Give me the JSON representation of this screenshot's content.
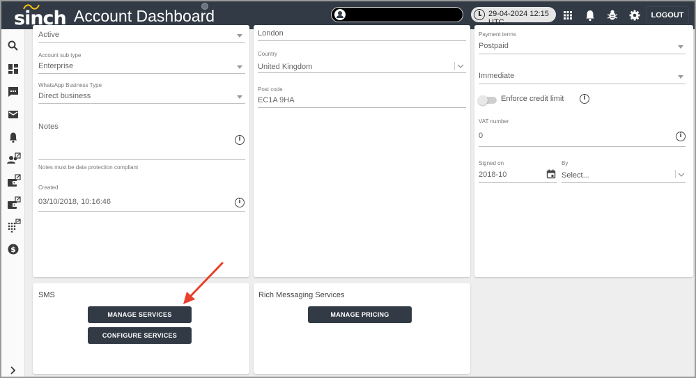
{
  "header": {
    "logo": "sinch",
    "title": "Account Dashboard",
    "datetime": "29-04-2024 12:15 UTC",
    "logout_label": "LOGOUT",
    "icons": [
      "apps-grid-icon",
      "bell-icon",
      "bug-icon",
      "gear-icon"
    ]
  },
  "sidebar": {
    "icons": [
      "search-icon",
      "dashboard-icon",
      "chat-icon",
      "mail-icon",
      "bell-icon",
      "users-external-icon",
      "wallet-external-icon",
      "wallet-external-icon",
      "dialpad-external-icon",
      "dollar-icon",
      "chevron-right-icon"
    ]
  },
  "left_card": {
    "status_value": "Active",
    "sub_type_label": "Account sub type",
    "sub_type_value": "Enterprise",
    "whatsapp_label": "WhatsApp Business Type",
    "whatsapp_value": "Direct business",
    "notes_label": "Notes",
    "notes_hint": "Notes must be data protection compliant",
    "created_label": "Created",
    "created_value": "03/10/2018, 10:16:46"
  },
  "middle_card": {
    "city_value": "London",
    "country_label": "Country",
    "country_value": "United Kingdom",
    "postcode_label": "Post code",
    "postcode_value": "EC1A 9HA"
  },
  "right_card": {
    "payment_terms_label": "Payment terms",
    "payment_terms_value": "Postpaid",
    "timing_value": "Immediate",
    "credit_limit_label": "Enforce credit limit",
    "vat_label": "VAT number",
    "vat_value": "0",
    "signed_on_label": "Signed on",
    "signed_on_value": "2018-10",
    "by_label": "By",
    "by_placeholder": "Select..."
  },
  "sms_card": {
    "title": "SMS",
    "manage_label": "MANAGE SERVICES",
    "configure_label": "CONFIGURE SERVICES"
  },
  "rms_card": {
    "title": "Rich Messaging Services",
    "pricing_label": "MANAGE PRICING"
  },
  "colors": {
    "header_bg": "#323b45",
    "button_bg": "#323b45",
    "logo_accent": "#f4c20d",
    "arrow": "#e8402b"
  }
}
